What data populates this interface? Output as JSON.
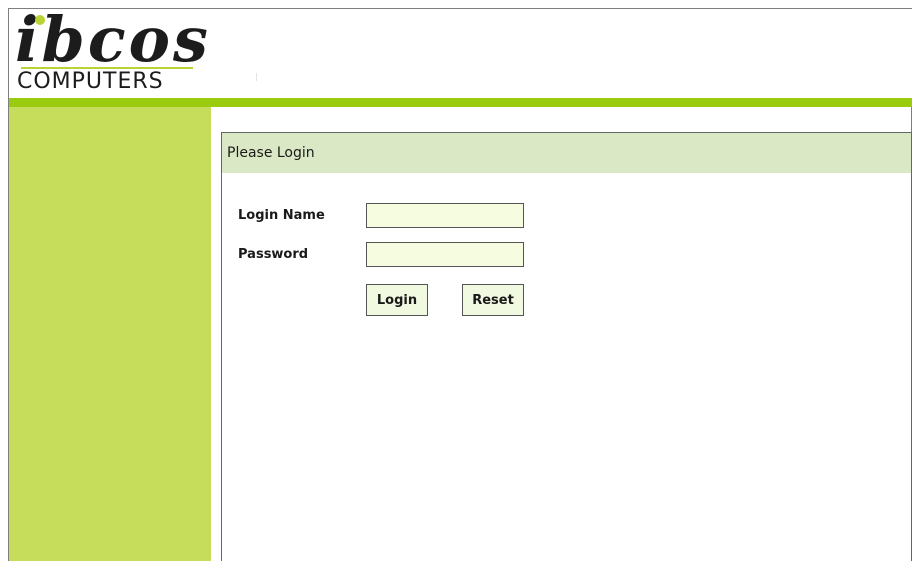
{
  "brand": {
    "logo_word": "ibcos",
    "logo_sub": "COMPUTERS",
    "accent_color": "#9bcb0e",
    "sidebar_color": "#c5dd5a"
  },
  "login_panel": {
    "title": "Please Login",
    "login_name_label": "Login Name",
    "login_name_value": "",
    "password_label": "Password",
    "password_value": "",
    "login_button": "Login",
    "reset_button": "Reset"
  }
}
